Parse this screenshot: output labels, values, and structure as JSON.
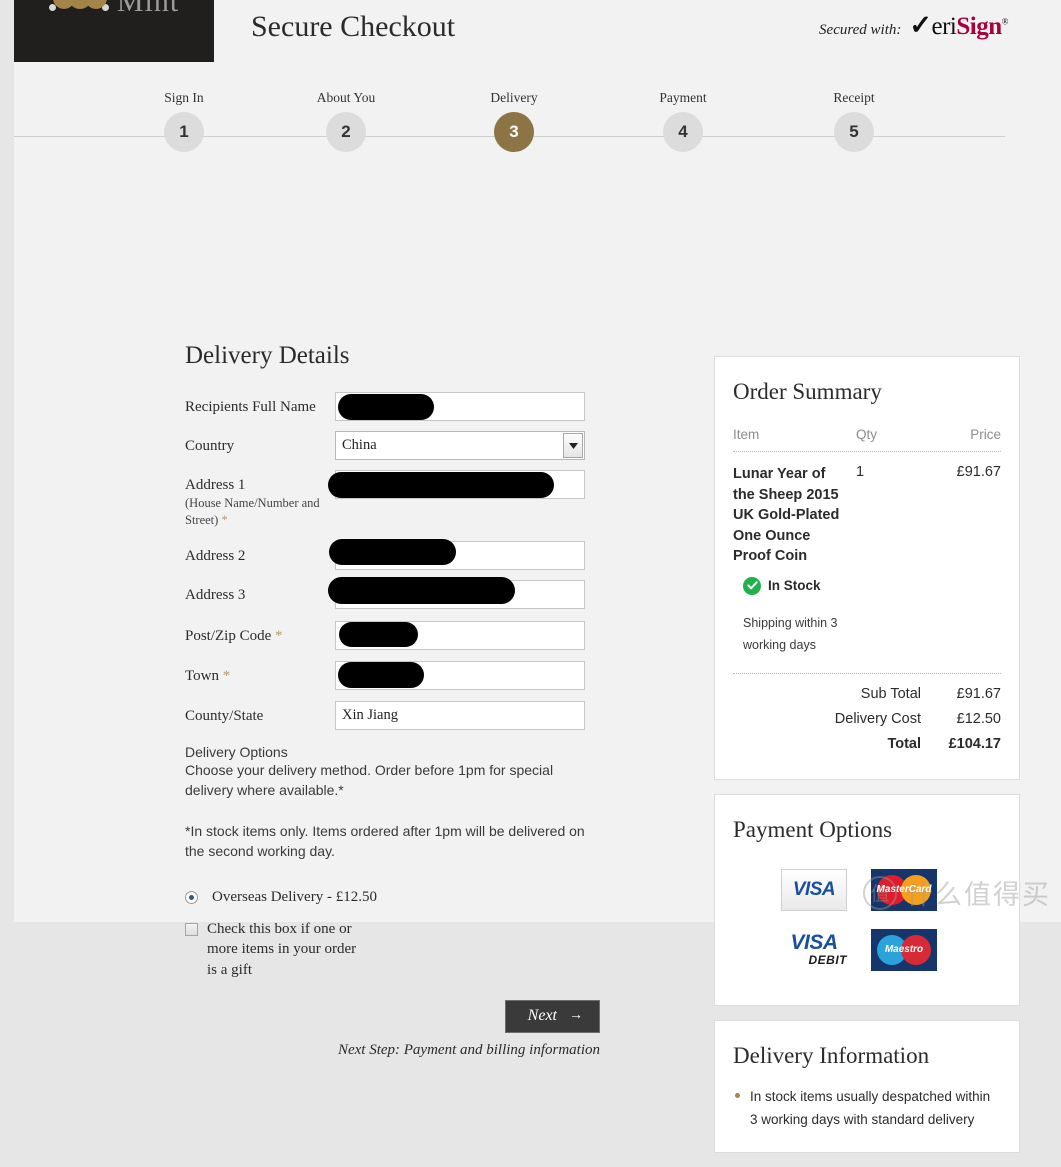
{
  "brand": {
    "name": "Mint",
    "logo_icon": "mint-coins-logo"
  },
  "header": {
    "title": "Secure Checkout",
    "secured_label": "Secured with:",
    "verisign": {
      "check": "✓",
      "veri": "eri",
      "sign": "Sign",
      "reg": "®"
    }
  },
  "stepper": {
    "steps": [
      {
        "label": "Sign In",
        "number": "1",
        "active": false
      },
      {
        "label": "About You",
        "number": "2",
        "active": false
      },
      {
        "label": "Delivery",
        "number": "3",
        "active": true
      },
      {
        "label": "Payment",
        "number": "4",
        "active": false
      },
      {
        "label": "Receipt",
        "number": "5",
        "active": false
      }
    ],
    "active_color": "#8c7444",
    "inactive_color": "#dcdcdc"
  },
  "form": {
    "title": "Delivery Details",
    "fields": [
      {
        "label": "Recipients Full Name",
        "sub": "",
        "required": false,
        "type": "text",
        "value": "",
        "redacted": true
      },
      {
        "label": "Country",
        "sub": "",
        "required": false,
        "type": "select",
        "value": "China",
        "redacted": false
      },
      {
        "label": "Address 1",
        "sub": "(House Name/Number and Street)",
        "required": true,
        "type": "text",
        "value": "",
        "redacted": true
      },
      {
        "label": "Address 2",
        "sub": "",
        "required": false,
        "type": "text",
        "value": "",
        "redacted": true
      },
      {
        "label": "Address 3",
        "sub": "",
        "required": false,
        "type": "text",
        "value": "",
        "redacted": true
      },
      {
        "label": "Post/Zip Code",
        "sub": "",
        "required": true,
        "type": "text",
        "value": "",
        "redacted": true
      },
      {
        "label": "Town",
        "sub": "",
        "required": true,
        "type": "text",
        "value": "",
        "redacted": true
      },
      {
        "label": "County/State",
        "sub": "",
        "required": false,
        "type": "text",
        "value": "Xin Jiang",
        "redacted": false
      }
    ],
    "required_marker": "*",
    "delivery_options": {
      "title": "Delivery Options",
      "text": "Choose your delivery method. Order before 1pm for special delivery where available.*",
      "note": "*In stock items only. Items ordered after 1pm will be delivered on the second working day.",
      "radio_label": "Overseas Delivery - £12.50",
      "radio_selected": true,
      "gift_label": "Check this box if one or more items in your order is a gift",
      "gift_checked": false
    },
    "next_button": "Next",
    "next_arrow": "→",
    "next_step_text": "Next Step: Payment and billing information"
  },
  "order_summary": {
    "title": "Order Summary",
    "columns": {
      "item": "Item",
      "qty": "Qty",
      "price": "Price"
    },
    "items": [
      {
        "name": "Lunar Year of the Sheep 2015 UK Gold-Plated One Ounce Proof Coin",
        "qty": "1",
        "price": "£91.67",
        "stock_status": "In Stock",
        "stock_icon": "check-circle-icon",
        "stock_color": "#22b14c",
        "shipping_note": "Shipping within 3 working days"
      }
    ],
    "totals": [
      {
        "label": "Sub Total",
        "value": "£91.67",
        "grand": false
      },
      {
        "label": "Delivery Cost",
        "value": "£12.50",
        "grand": false
      },
      {
        "label": "Total",
        "value": "£104.17",
        "grand": true
      }
    ]
  },
  "payment_options": {
    "title": "Payment Options",
    "cards": [
      {
        "name": "visa-card-logo",
        "label": "VISA",
        "sublabel": ""
      },
      {
        "name": "mastercard-logo",
        "label": "MasterCard",
        "sublabel": ""
      },
      {
        "name": "visa-debit-card-logo",
        "label": "VISA",
        "sublabel": "DEBIT"
      },
      {
        "name": "maestro-card-logo",
        "label": "Maestro",
        "sublabel": ""
      }
    ]
  },
  "delivery_information": {
    "title": "Delivery Information",
    "bullets": [
      "In stock items usually despatched within 3 working days with standard delivery"
    ]
  },
  "watermark": {
    "logo": "值",
    "text": "什么值得买"
  }
}
